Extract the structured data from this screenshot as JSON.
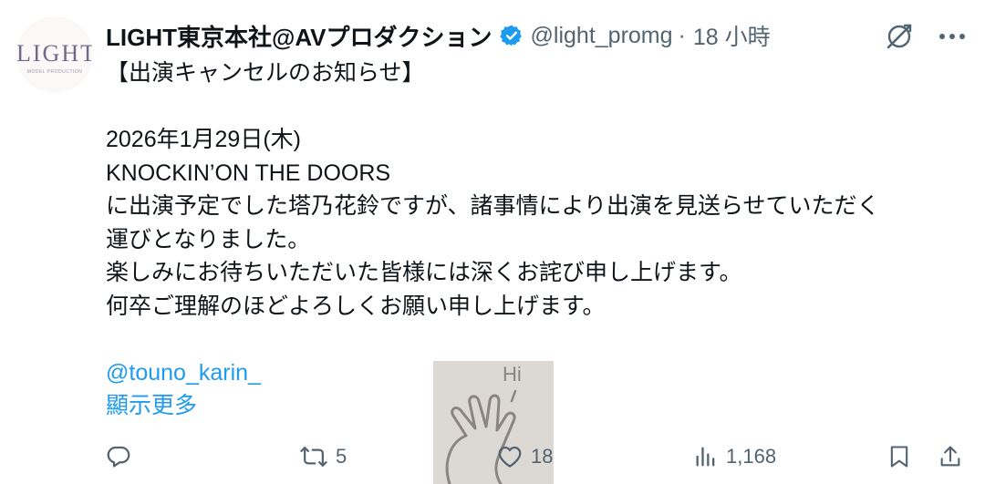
{
  "author": {
    "display_name": "LIGHT東京本社@AVプロダクション",
    "handle": "@light_promg",
    "separator": "·",
    "timestamp": "18 小時",
    "avatar_logo": "LIGHT",
    "avatar_logo_sub": "MODEL PRODUCTION"
  },
  "tweet": {
    "lines": [
      "【出演キャンセルのお知らせ】",
      "",
      "2026年1月29日(木)",
      "KNOCKIN’ON THE DOORS",
      "に出演予定でした塔乃花鈴ですが、諸事情により出演を見送らせていただく",
      "運びとなりました。",
      "楽しみにお待ちいただいた皆様には深くお詫び申し上げます。",
      "何卒ご理解のほどよろしくお願い申し上げます。",
      ""
    ],
    "mention": "@touno_karin_",
    "show_more": "顯示更多"
  },
  "media": {
    "text": "Hi",
    "background": "#dcd8d3"
  },
  "actions": {
    "reply_count": "",
    "retweet_count": "5",
    "like_count": "18",
    "views_count": "1,168"
  },
  "colors": {
    "accent": "#1d9bf0",
    "text": "#0f1419",
    "secondary": "#536471",
    "verified": "#1d9bf0"
  },
  "icons": [
    "verified-badge-icon",
    "grok-icon",
    "more-icon",
    "reply-icon",
    "retweet-icon",
    "like-icon",
    "views-icon",
    "bookmark-icon",
    "share-icon"
  ]
}
